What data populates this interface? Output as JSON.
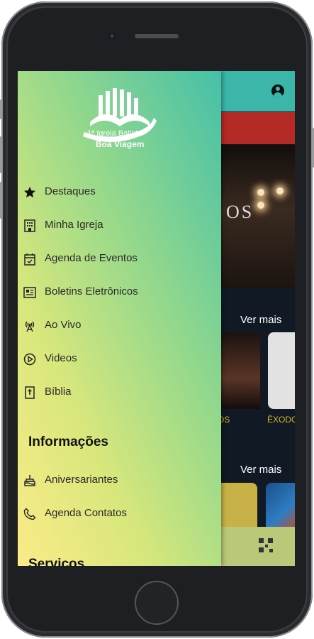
{
  "logo": {
    "line1": "1ª Igreja Batista",
    "line2": "Boa Viagem"
  },
  "menu": {
    "items": [
      {
        "label": "Destaques",
        "icon": "star-icon"
      },
      {
        "label": "Minha Igreja",
        "icon": "building-icon"
      },
      {
        "label": "Agenda de Eventos",
        "icon": "calendar-icon"
      },
      {
        "label": "Boletins Eletrônicos",
        "icon": "newspaper-icon"
      },
      {
        "label": "Ao Vivo",
        "icon": "broadcast-icon"
      },
      {
        "label": "Videos",
        "icon": "play-icon"
      },
      {
        "label": "Bíblia",
        "icon": "bible-icon"
      }
    ]
  },
  "info": {
    "title": "Informações",
    "items": [
      {
        "label": "Aniversariantes",
        "icon": "cake-icon"
      },
      {
        "label": "Agenda Contatos",
        "icon": "phone-icon"
      }
    ]
  },
  "services": {
    "title": "Serviços"
  },
  "background": {
    "stage_word": "OS",
    "see_more_1": "Ver mais",
    "see_more_2": "Ver mais",
    "thumb1_label": "OS",
    "thumb2_label": "ÊXODO"
  },
  "colors": {
    "topbar": "#3bb6a9",
    "banner": "#b42a26",
    "drawer_gradient_start": "#fbeb88",
    "drawer_gradient_end": "#45c0a8",
    "accent_label": "#d6b22a"
  }
}
